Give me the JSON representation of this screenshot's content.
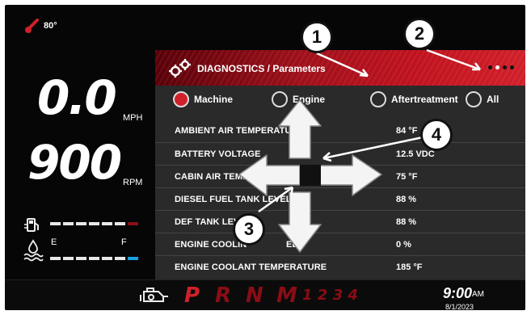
{
  "temperature": "80°",
  "speed": {
    "value": "0.0",
    "unit": "MPH"
  },
  "rpm": {
    "value": "900",
    "unit": "RPM"
  },
  "def_gauge": {
    "empty_label": "E",
    "full_label": "F"
  },
  "header": {
    "title": "DIAGNOSTICS / Parameters"
  },
  "tabs": [
    {
      "label": "Machine",
      "selected": true
    },
    {
      "label": "Engine",
      "selected": false
    },
    {
      "label": "Aftertreatment",
      "selected": false
    },
    {
      "label": "All",
      "selected": false
    }
  ],
  "parameters": [
    {
      "name": "AMBIENT AIR TEMPERATURE",
      "value": "84 °F"
    },
    {
      "name": "BATTERY VOLTAGE",
      "value": "12.5 VDC"
    },
    {
      "name": "CABIN AIR TEMPER",
      "value": "75 °F"
    },
    {
      "name": "DIESEL FUEL TANK LEVEL",
      "value": "88 %"
    },
    {
      "name": "DEF TANK LEVEL",
      "value": "88 %"
    },
    {
      "name": "ENGINE COOLIN",
      "name_suffix": "ED",
      "value": "0 %"
    },
    {
      "name": "ENGINE COOLANT TEMPERATURE",
      "value": "185 °F"
    }
  ],
  "gears": {
    "p": "P",
    "r": "R",
    "n": "N",
    "m": "M",
    "numbers": "1 2 3 4"
  },
  "clock": {
    "time": "9:00",
    "ampm": "AM",
    "date": "8/1/2023"
  },
  "callouts": {
    "c1": "1",
    "c2": "2",
    "c3": "3",
    "c4": "4"
  },
  "colors": {
    "accent": "#d0202a",
    "gear_active": "#d0202a",
    "def_full": "#1aa0e0"
  }
}
